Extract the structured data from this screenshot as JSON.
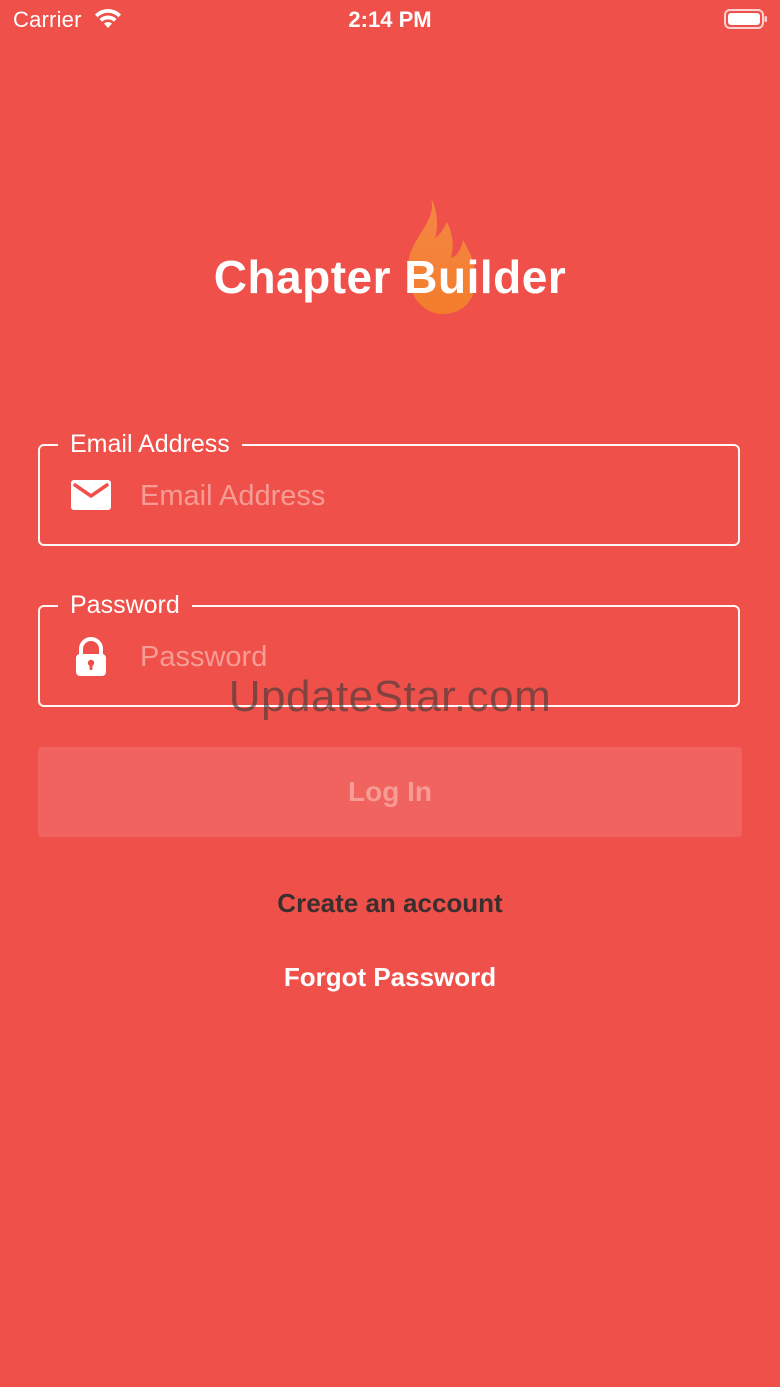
{
  "colors": {
    "background": "#ef5049",
    "text": "#ffffff",
    "placeholder": "#f79b95",
    "button_bg": "#f1635e",
    "button_text": "#f79b95",
    "link_dark": "#3a2f2e",
    "watermark": "#3a3a3a",
    "flame_top": "#f58a45",
    "flame_bottom": "#f47f2a"
  },
  "status_bar": {
    "carrier": "Carrier",
    "time": "2:14 PM",
    "wifi_icon": "wifi-icon",
    "battery_icon": "battery-icon"
  },
  "logo": {
    "text": "Chapter Builder",
    "icon": "flame-icon"
  },
  "form": {
    "email": {
      "label": "Email Address",
      "placeholder": "Email Address",
      "value": "",
      "icon": "mail-icon"
    },
    "password": {
      "label": "Password",
      "placeholder": "Password",
      "value": "",
      "icon": "lock-icon"
    },
    "login_label": "Log In"
  },
  "links": {
    "create_account": "Create an account",
    "forgot_password": "Forgot Password"
  },
  "watermark": "UpdateStar.com"
}
